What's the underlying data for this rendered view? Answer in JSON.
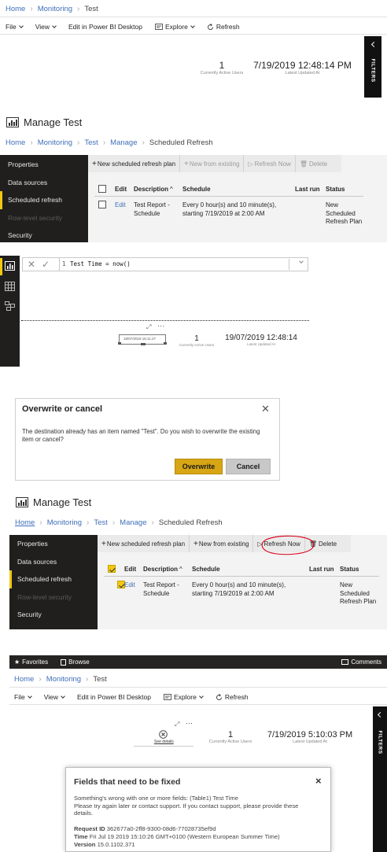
{
  "colors": {
    "link": "#3f6fb9",
    "accent": "#f2c811",
    "dark": "#201f1e",
    "red_annotation": "#d9001b"
  },
  "p1": {
    "breadcrumb": [
      "Home",
      "Monitoring",
      "Test"
    ],
    "menu": {
      "file": "File",
      "view": "View",
      "edit": "Edit in Power BI Desktop",
      "explore": "Explore",
      "refresh": "Refresh"
    },
    "kpi_value": "1",
    "kpi_label": "Currently Active Users",
    "date_value": "7/19/2019 12:48:14 PM",
    "date_label": "Latest Updated At",
    "filters": "FILTERS"
  },
  "p2": {
    "title": "Manage Test",
    "breadcrumb": [
      "Home",
      "Monitoring",
      "Test",
      "Manage",
      "Scheduled Refresh"
    ],
    "sidebar": [
      "Properties",
      "Data sources",
      "Scheduled refresh",
      "Row-level security",
      "Security"
    ],
    "toolbar": {
      "new_plan": "New scheduled refresh plan",
      "new_existing": "New from existing",
      "refresh_now": "Refresh Now",
      "delete": "Delete"
    },
    "table": {
      "headers": [
        "Edit",
        "Description",
        "Schedule",
        "Last run",
        "Status"
      ],
      "row": {
        "edit": "Edit",
        "description": [
          "Test Report -",
          "Schedule"
        ],
        "schedule": [
          "Every 0 hour(s) and 10 minute(s),",
          "starting 7/19/2019 at 2:00 AM"
        ],
        "last_run": "",
        "status": [
          "New",
          "Scheduled",
          "Refresh Plan"
        ]
      }
    }
  },
  "p3": {
    "formula_line": "1",
    "formula": "Test Time = now()",
    "card_value": "19/07/2019 15:11:27",
    "kpi_value": "1",
    "kpi_label": "Currently Active Users",
    "date_value": "19/07/2019 12:48:14",
    "date_label": "Latest Updated At",
    "more": "···"
  },
  "p4": {
    "title": "Overwrite or cancel",
    "message": [
      "The destination already has an item named \"Test\". Do you wish to overwrite the existing",
      "item or cancel?"
    ],
    "overwrite": "Overwrite",
    "cancel": "Cancel"
  },
  "p5": {
    "title": "Manage Test",
    "breadcrumb": [
      "Home",
      "Monitoring",
      "Test",
      "Manage",
      "Scheduled Refresh"
    ],
    "sidebar": [
      "Properties",
      "Data sources",
      "Scheduled refresh",
      "Row-level security",
      "Security"
    ],
    "toolbar": {
      "new_plan": "New scheduled refresh plan",
      "new_existing": "New from existing",
      "refresh_now": "Refresh Now",
      "delete": "Delete"
    },
    "table": {
      "headers": [
        "Edit",
        "Description",
        "Schedule",
        "Last run",
        "Status"
      ],
      "row": {
        "edit": "Edit",
        "description": [
          "Test Report -",
          "Schedule"
        ],
        "schedule": [
          "Every 0 hour(s) and 10 minute(s),",
          "starting 7/19/2019 at 2:00 AM"
        ],
        "status": [
          "New",
          "Scheduled",
          "Refresh Plan"
        ]
      }
    }
  },
  "p6": {
    "topbar": {
      "favorites": "Favorites",
      "browse": "Browse",
      "comments": "Comments"
    },
    "breadcrumb": [
      "Home",
      "Monitoring",
      "Test"
    ],
    "menu": {
      "file": "File",
      "view": "View",
      "edit": "Edit in Power BI Desktop",
      "explore": "Explore",
      "refresh": "Refresh"
    },
    "see_details": "See details",
    "kpi_value": "1",
    "kpi_label": "Currently Active Users",
    "date_value": "7/19/2019 5:10:03 PM",
    "date_label": "Latest Updated At",
    "filters": "FILTERS",
    "error": {
      "title": "Fields that need to be fixed",
      "close": "×",
      "message": [
        "Something's wrong with one or more fields: (Table1) Test Time",
        "Please try again later or contact support. If you contact support, please provide these",
        "details."
      ],
      "request_id_label": "Request ID",
      "request_id": "362677a0-2ff8-9300-08d6-77028735ef9d",
      "time_label": "Time",
      "time": "Fri Jul 19 2019 15:10:26 GMT+0100 (Western European Summer Time)",
      "version_label": "Version",
      "version": "15.0.1102.371"
    }
  }
}
